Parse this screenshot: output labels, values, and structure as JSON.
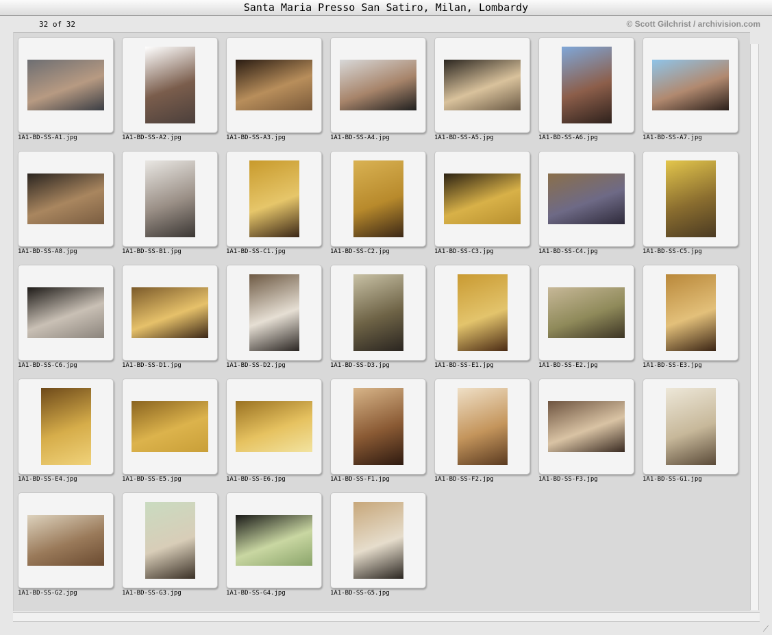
{
  "window": {
    "title": "Santa Maria Presso San Satiro, Milan, Lombardy"
  },
  "header": {
    "counter": "32 of 32",
    "credit": "© Scott Gilchrist / archivision.com"
  },
  "thumbnails": [
    {
      "file": "1A1-BD-SS-A1.jpg",
      "orientation": "landscape",
      "colors": [
        "#6d6e72",
        "#b79a82",
        "#3a3d44"
      ]
    },
    {
      "file": "1A1-BD-SS-A2.jpg",
      "orientation": "portrait",
      "colors": [
        "#ffffff",
        "#7a5d4c",
        "#4b3f3b"
      ]
    },
    {
      "file": "1A1-BD-SS-A3.jpg",
      "orientation": "landscape",
      "colors": [
        "#2a1c12",
        "#b88e5b",
        "#7a5a3a"
      ]
    },
    {
      "file": "1A1-BD-SS-A4.jpg",
      "orientation": "landscape",
      "colors": [
        "#d8d8d8",
        "#a7846a",
        "#1f1f1f"
      ]
    },
    {
      "file": "1A1-BD-SS-A5.jpg",
      "orientation": "landscape",
      "colors": [
        "#2b2620",
        "#d9c29c",
        "#6b5a45"
      ]
    },
    {
      "file": "1A1-BD-SS-A6.jpg",
      "orientation": "portrait",
      "colors": [
        "#7fa7d8",
        "#8c5e4a",
        "#2e211c"
      ]
    },
    {
      "file": "1A1-BD-SS-A7.jpg",
      "orientation": "landscape",
      "colors": [
        "#8fc4e8",
        "#b1896f",
        "#2a1f1a"
      ]
    },
    {
      "file": "1A1-BD-SS-A8.jpg",
      "orientation": "landscape",
      "colors": [
        "#2b2520",
        "#a9865f",
        "#7a5d41"
      ]
    },
    {
      "file": "1A1-BD-SS-B1.jpg",
      "orientation": "portrait",
      "colors": [
        "#e9e7e3",
        "#9a8f86",
        "#3a3633"
      ]
    },
    {
      "file": "1A1-BD-SS-C1.jpg",
      "orientation": "portrait",
      "colors": [
        "#c89a2c",
        "#e6c66a",
        "#3a2616"
      ]
    },
    {
      "file": "1A1-BD-SS-C2.jpg",
      "orientation": "portrait",
      "colors": [
        "#d9b253",
        "#b88a2c",
        "#3b2716"
      ]
    },
    {
      "file": "1A1-BD-SS-C3.jpg",
      "orientation": "landscape",
      "colors": [
        "#2c2212",
        "#d8b148",
        "#b8902f"
      ]
    },
    {
      "file": "1A1-BD-SS-C4.jpg",
      "orientation": "landscape",
      "colors": [
        "#8a6f4a",
        "#6e6a86",
        "#2e2a3a"
      ]
    },
    {
      "file": "1A1-BD-SS-C5.jpg",
      "orientation": "portrait",
      "colors": [
        "#e3c64c",
        "#8a6d2f",
        "#4a3a22"
      ]
    },
    {
      "file": "1A1-BD-SS-C6.jpg",
      "orientation": "landscape",
      "colors": [
        "#1e1b18",
        "#c9c0b5",
        "#8b847c"
      ]
    },
    {
      "file": "1A1-BD-SS-D1.jpg",
      "orientation": "landscape",
      "colors": [
        "#7b5a2a",
        "#e6c16a",
        "#3a2616"
      ]
    },
    {
      "file": "1A1-BD-SS-D2.jpg",
      "orientation": "portrait",
      "colors": [
        "#6e5a44",
        "#e6dfd4",
        "#2a2522"
      ]
    },
    {
      "file": "1A1-BD-SS-D3.jpg",
      "orientation": "portrait",
      "colors": [
        "#c8c1a5",
        "#6e6346",
        "#2a2520"
      ]
    },
    {
      "file": "1A1-BD-SS-E1.jpg",
      "orientation": "portrait",
      "colors": [
        "#c99a32",
        "#e3c46c",
        "#4a2a14"
      ]
    },
    {
      "file": "1A1-BD-SS-E2.jpg",
      "orientation": "landscape",
      "colors": [
        "#c7b898",
        "#8f8a5a",
        "#3c3424"
      ]
    },
    {
      "file": "1A1-BD-SS-E3.jpg",
      "orientation": "portrait",
      "colors": [
        "#b9883a",
        "#e3c07a",
        "#3a2414"
      ]
    },
    {
      "file": "1A1-BD-SS-E4.jpg",
      "orientation": "portrait",
      "colors": [
        "#6e4a1a",
        "#d6ad4a",
        "#f0d27a"
      ]
    },
    {
      "file": "1A1-BD-SS-E5.jpg",
      "orientation": "landscape",
      "colors": [
        "#8a6420",
        "#dcb34c",
        "#c99f38"
      ]
    },
    {
      "file": "1A1-BD-SS-E6.jpg",
      "orientation": "landscape",
      "colors": [
        "#9a7222",
        "#e6c260",
        "#f2e3a0"
      ]
    },
    {
      "file": "1A1-BD-SS-F1.jpg",
      "orientation": "portrait",
      "colors": [
        "#d7b488",
        "#8a5a34",
        "#2e1a10"
      ]
    },
    {
      "file": "1A1-BD-SS-F2.jpg",
      "orientation": "portrait",
      "colors": [
        "#efdfc6",
        "#c4955c",
        "#5a3a20"
      ]
    },
    {
      "file": "1A1-BD-SS-F3.jpg",
      "orientation": "landscape",
      "colors": [
        "#6e5440",
        "#d9c3a4",
        "#3a2b22"
      ]
    },
    {
      "file": "1A1-BD-SS-G1.jpg",
      "orientation": "portrait",
      "colors": [
        "#ede7d8",
        "#c7b89a",
        "#5a4a38"
      ]
    },
    {
      "file": "1A1-BD-SS-G2.jpg",
      "orientation": "landscape",
      "colors": [
        "#ddd2bd",
        "#9a7a5a",
        "#6a4a30"
      ]
    },
    {
      "file": "1A1-BD-SS-G3.jpg",
      "orientation": "portrait",
      "colors": [
        "#c9dbc0",
        "#d8cdb8",
        "#3a3026"
      ]
    },
    {
      "file": "1A1-BD-SS-G4.jpg",
      "orientation": "landscape",
      "colors": [
        "#1a1a18",
        "#c9d7a2",
        "#8aa46a"
      ]
    },
    {
      "file": "1A1-BD-SS-G5.jpg",
      "orientation": "portrait",
      "colors": [
        "#c7a77a",
        "#e6ddcc",
        "#2a2520"
      ]
    }
  ]
}
